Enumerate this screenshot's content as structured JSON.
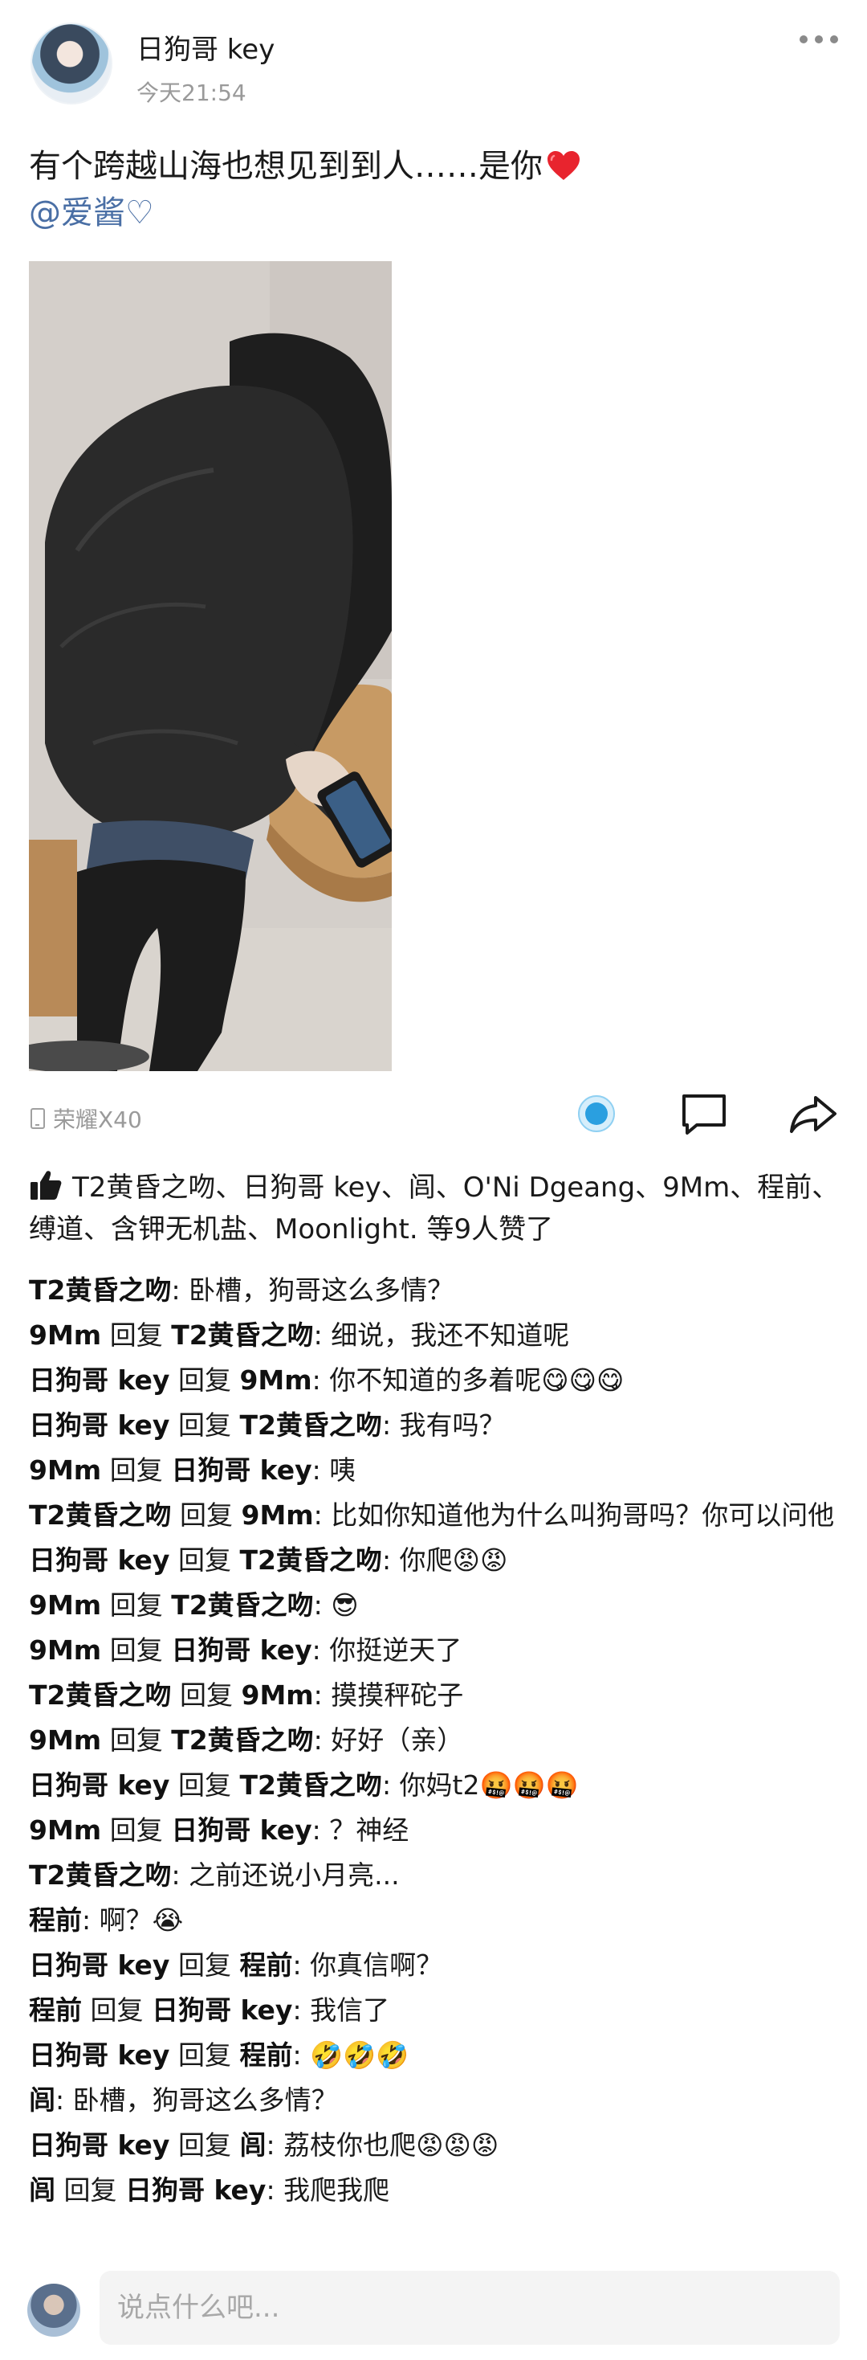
{
  "post": {
    "author": "日狗哥 key",
    "time": "今天21:54",
    "text": "有个跨越山海也想见到到人……是你",
    "mention": "@爱酱♡",
    "device": "荣耀X40"
  },
  "icons": {
    "more": "more-dots-icon",
    "like": "like-circle-icon",
    "comment": "comment-bubble-icon",
    "share": "share-arrow-icon",
    "heart": "red-heart-emoji",
    "thumb": "thumbs-up-icon"
  },
  "colors": {
    "mention": "#4a6fa5",
    "like_accent": "#2a9fe0",
    "muted": "#9a9a9a"
  },
  "likes": {
    "text": "T2黄昏之吻、日狗哥 key、闾、O'Ni Dgeang、9Mm、程前、缚道、含钾无机盐、Moonlight. 等9人赞了"
  },
  "comments": [
    {
      "name": "T2黄昏之吻",
      "reply": "",
      "target": "",
      "text": "卧槽，狗哥这么多情？"
    },
    {
      "name": "9Mm",
      "reply": "回复",
      "target": "T2黄昏之吻",
      "text": "细说，我还不知道呢"
    },
    {
      "name": "日狗哥 key",
      "reply": "回复",
      "target": "9Mm",
      "text": "你不知道的多着呢😋😋😋"
    },
    {
      "name": "日狗哥 key",
      "reply": "回复",
      "target": "T2黄昏之吻",
      "text": "我有吗？"
    },
    {
      "name": "9Mm",
      "reply": "回复",
      "target": "日狗哥 key",
      "text": "咦"
    },
    {
      "name": "T2黄昏之吻",
      "reply": "回复",
      "target": "9Mm",
      "text": "比如你知道他为什么叫狗哥吗？你可以问他"
    },
    {
      "name": "日狗哥 key",
      "reply": "回复",
      "target": "T2黄昏之吻",
      "text": "你爬😡😡"
    },
    {
      "name": "9Mm",
      "reply": "回复",
      "target": "T2黄昏之吻",
      "text": "😎"
    },
    {
      "name": "9Mm",
      "reply": "回复",
      "target": "日狗哥 key",
      "text": "你挺逆天了"
    },
    {
      "name": "T2黄昏之吻",
      "reply": "回复",
      "target": "9Mm",
      "text": "摸摸秤砣子"
    },
    {
      "name": "9Mm",
      "reply": "回复",
      "target": "T2黄昏之吻",
      "text": "好好（亲）"
    },
    {
      "name": "日狗哥 key",
      "reply": "回复",
      "target": "T2黄昏之吻",
      "text": "你妈t2🤬🤬🤬"
    },
    {
      "name": "9Mm",
      "reply": "回复",
      "target": "日狗哥 key",
      "text": "？神经"
    },
    {
      "name": "T2黄昏之吻",
      "reply": "",
      "target": "",
      "text": "之前还说小月亮..."
    },
    {
      "name": "程前",
      "reply": "",
      "target": "",
      "text": "啊？😭"
    },
    {
      "name": "日狗哥 key",
      "reply": "回复",
      "target": "程前",
      "text": "你真信啊？"
    },
    {
      "name": "程前",
      "reply": "回复",
      "target": "日狗哥 key",
      "text": "我信了"
    },
    {
      "name": "日狗哥 key",
      "reply": "回复",
      "target": "程前",
      "text": "🤣🤣🤣"
    },
    {
      "name": "闾",
      "reply": "",
      "target": "",
      "text": "卧槽，狗哥这么多情？"
    },
    {
      "name": "日狗哥 key",
      "reply": "回复",
      "target": "闾",
      "text": "荔枝你也爬😡😡😡"
    },
    {
      "name": "闾",
      "reply": "回复",
      "target": "日狗哥 key",
      "text": "我爬我爬"
    }
  ],
  "composer": {
    "placeholder": "说点什么吧..."
  }
}
